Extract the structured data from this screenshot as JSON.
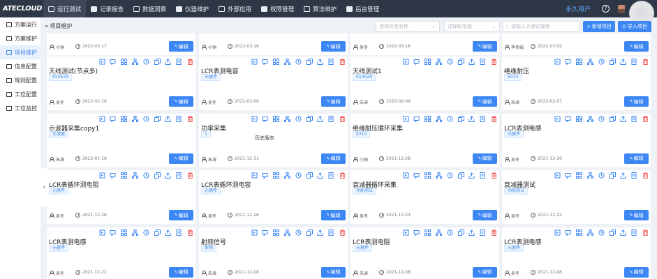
{
  "app": {
    "logo": "ATECLOUD"
  },
  "nav": [
    {
      "label": "运行测试",
      "active": true,
      "icon": "play-icon"
    },
    {
      "label": "记录报告",
      "active": false,
      "icon": "report-icon"
    },
    {
      "label": "数据洞察",
      "active": false,
      "icon": "insight-icon"
    },
    {
      "label": "仪器维护",
      "active": false,
      "icon": "instrument-icon"
    },
    {
      "label": "外部应用",
      "active": false,
      "icon": "external-icon"
    },
    {
      "label": "权限管理",
      "active": false,
      "icon": "permission-icon"
    },
    {
      "label": "算法维护",
      "active": false,
      "icon": "algorithm-icon"
    },
    {
      "label": "后台管理",
      "active": false,
      "icon": "admin-icon"
    }
  ],
  "user": {
    "name": "永久用户",
    "help": "?"
  },
  "sidebar": {
    "items": [
      {
        "label": "方案运行",
        "active": false
      },
      {
        "label": "方案维护",
        "active": false
      },
      {
        "label": "项目维护",
        "active": true
      },
      {
        "label": "信息配置",
        "active": false
      },
      {
        "label": "规则配置",
        "active": false
      },
      {
        "label": "工位配置",
        "active": false
      },
      {
        "label": "工位监控",
        "active": false
      }
    ],
    "collapse": "‹"
  },
  "toolbar": {
    "breadcrumb": "项目维护",
    "select1_placeholder": "选择标签名称",
    "select2_placeholder": "选择标签值",
    "search_placeholder": "请输入关键词搜索",
    "new_label": "新增项目",
    "import_label": "导入项目"
  },
  "edit_label": "编辑",
  "tooltip": "历史版本",
  "cards": [
    {
      "title": "",
      "tag": "",
      "owner": "小钠",
      "date": "2022-03-17"
    },
    {
      "title": "",
      "tag": "",
      "owner": "小钠",
      "date": "2022-03-16"
    },
    {
      "title": "",
      "tag": "",
      "owner": "吴冬",
      "date": "2022-03-16"
    },
    {
      "title": "",
      "tag": "",
      "owner": "李伟娟",
      "date": "2022-03-02"
    },
    {
      "title": "天线测试(节点多)",
      "tag": "E5062A",
      "owner": "吴冬",
      "date": "2022-02-16"
    },
    {
      "title": "LCR表测电容",
      "tag": "元器件",
      "owner": "吴冬",
      "date": "2022-02-09"
    },
    {
      "title": "天线测试1",
      "tag": "E5062A",
      "owner": "朱涛",
      "date": "2022-02-09"
    },
    {
      "title": "绝缘耐压",
      "tag": "8310",
      "owner": "朱涛",
      "date": "2022-02-07"
    },
    {
      "title": "示波器采集copy1",
      "tag": "示波器",
      "owner": "朱涛",
      "date": "2022-01-18"
    },
    {
      "title": "功率采集",
      "tag": "1",
      "owner": "朱涛",
      "date": "2021-12-31"
    },
    {
      "title": "绝缘耐压循环采集",
      "tag": "8310",
      "owner": "小钠",
      "date": "2021-12-28"
    },
    {
      "title": "LCR表测电感",
      "tag": "元器件",
      "owner": "吴冬",
      "date": "2021-12-26"
    },
    {
      "title": "LCR表循环测电阻",
      "tag": "元器件",
      "owner": "吴冬",
      "date": "2021-12-26"
    },
    {
      "title": "LCR表循环测电容",
      "tag": "元器件",
      "owner": "吴冬",
      "date": "2021-12-26"
    },
    {
      "title": "衰减器循环采集",
      "tag": "功能测试",
      "owner": "吴冬",
      "date": "2021-12-23"
    },
    {
      "title": "衰减器测试",
      "tag": "功能测试",
      "owner": "吴冬",
      "date": "2021-12-22"
    },
    {
      "title": "LCR表测电感",
      "tag": "元器件",
      "owner": "吴冬",
      "date": "2021-12-22"
    },
    {
      "title": "射频信号",
      "tag": "射频",
      "owner": "朱涛",
      "date": "2021-12-08"
    },
    {
      "title": "LCR表测电阻",
      "tag": "元器件",
      "owner": "朱涛",
      "date": "2021-12-08"
    },
    {
      "title": "LCR表测电感",
      "tag": "元器件",
      "owner": "吴冬",
      "date": "2021-12-08"
    }
  ],
  "card_actions": [
    "preview-icon",
    "comment-icon",
    "hierarchy-icon",
    "tree-icon",
    "history-icon",
    "copy-icon",
    "export-icon",
    "edit-doc-icon",
    "delete-icon"
  ],
  "colors": {
    "accent": "#3d87f5",
    "topbar": "#2e3746",
    "delete": "#f25c5c"
  }
}
